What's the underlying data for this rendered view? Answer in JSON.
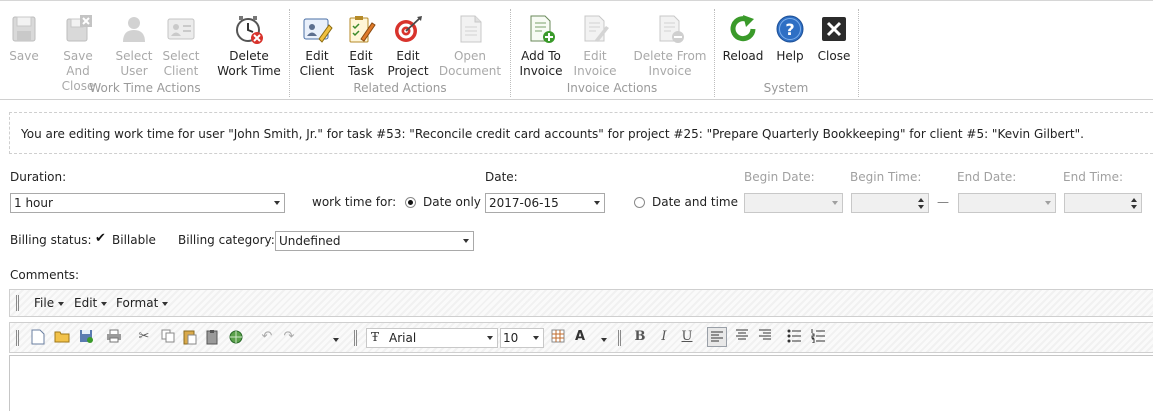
{
  "ribbon": {
    "groups": [
      {
        "label": "Work Time Actions"
      },
      {
        "label": "Related Actions"
      },
      {
        "label": "Invoice Actions"
      },
      {
        "label": "System"
      }
    ],
    "buttons": {
      "save": {
        "line1": "Save",
        "line2": "",
        "icon": "floppy-disk-icon"
      },
      "save_close": {
        "line1": "Save And",
        "line2": "Close",
        "icon": "floppy-disk-close-icon"
      },
      "select_user": {
        "line1": "Select",
        "line2": "User",
        "icon": "user-icon"
      },
      "select_client": {
        "line1": "Select",
        "line2": "Client",
        "icon": "client-card-icon"
      },
      "delete_work_time": {
        "line1": "Delete",
        "line2": "Work Time",
        "icon": "clock-delete-icon"
      },
      "edit_client": {
        "line1": "Edit",
        "line2": "Client",
        "icon": "client-edit-icon"
      },
      "edit_task": {
        "line1": "Edit",
        "line2": "Task",
        "icon": "task-edit-icon"
      },
      "edit_project": {
        "line1": "Edit",
        "line2": "Project",
        "icon": "target-icon"
      },
      "open_document": {
        "line1": "Open",
        "line2": "Document",
        "icon": "document-icon"
      },
      "add_to_invoice": {
        "line1": "Add To",
        "line2": "Invoice",
        "icon": "invoice-add-icon"
      },
      "edit_invoice": {
        "line1": "Edit",
        "line2": "Invoice",
        "icon": "invoice-edit-icon"
      },
      "delete_from_invoice": {
        "line1": "Delete From",
        "line2": "Invoice",
        "icon": "invoice-delete-icon"
      },
      "reload": {
        "line1": "Reload",
        "line2": "",
        "icon": "reload-icon"
      },
      "help": {
        "line1": "Help",
        "line2": "",
        "icon": "help-icon"
      },
      "close": {
        "line1": "Close",
        "line2": "",
        "icon": "close-icon"
      }
    }
  },
  "info_text": "You are editing work time for user \"John Smith, Jr.\" for task #53: \"Reconcile credit card accounts\" for project #25: \"Prepare Quarterly Bookkeeping\" for client #5: \"Kevin Gilbert\".",
  "form": {
    "duration_label": "Duration:",
    "duration_value": "1 hour",
    "work_time_for_label": "work time for:",
    "date_only_label": "Date only",
    "date_label": "Date:",
    "date_value": "2017-06-15",
    "date_and_time_label": "Date and time",
    "begin_date_label": "Begin Date:",
    "begin_time_label": "Begin Time:",
    "end_date_label": "End Date:",
    "end_time_label": "End Time:",
    "range_dash": "—",
    "billing_status_label": "Billing status:",
    "billable_label": "Billable",
    "billable_checked": true,
    "billing_category_label": "Billing category:",
    "billing_category_value": "Undefined",
    "comments_label": "Comments:"
  },
  "editor": {
    "menus": [
      "File",
      "Edit",
      "Format"
    ],
    "font_name": "Arial",
    "font_size": "10",
    "font_icon": "font-family-icon"
  },
  "colors": {
    "disabled_text": "#a9a9a9",
    "reload_green": "#3a9a2a",
    "help_blue": "#2e6fc4",
    "close_dark": "#2b2b2b",
    "target_red": "#d8332c"
  }
}
